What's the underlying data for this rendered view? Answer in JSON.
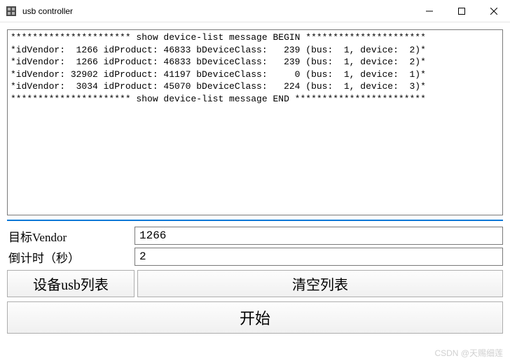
{
  "window": {
    "title": "usb controller"
  },
  "log": {
    "lines": [
      "********************** show device-list message BEGIN **********************",
      "*idVendor:  1266 idProduct: 46833 bDeviceClass:   239 (bus:  1, device:  2)*",
      "*idVendor:  1266 idProduct: 46833 bDeviceClass:   239 (bus:  1, device:  2)*",
      "*idVendor: 32902 idProduct: 41197 bDeviceClass:     0 (bus:  1, device:  1)*",
      "*idVendor:  3034 idProduct: 45070 bDeviceClass:   224 (bus:  1, device:  3)*",
      "********************** show device-list message END ************************"
    ]
  },
  "form": {
    "vendor_label": "目标Vendor",
    "vendor_value": "1266",
    "countdown_label": "倒计时（秒）",
    "countdown_value": "2"
  },
  "buttons": {
    "list_devices": "设备usb列表",
    "clear_list": "清空列表",
    "start": "开始"
  },
  "watermark": "CSDN @天赐细莲"
}
